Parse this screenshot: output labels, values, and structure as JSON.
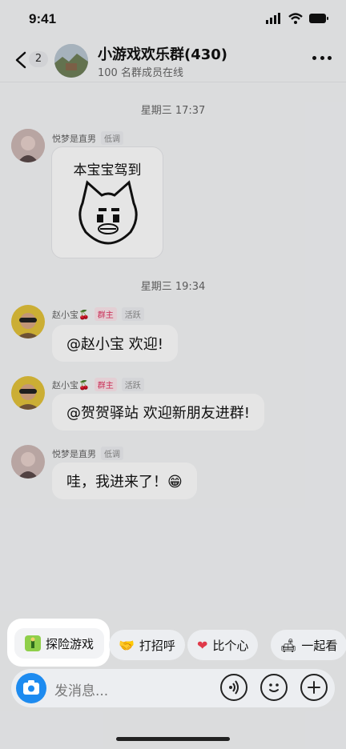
{
  "status": {
    "time": "9:41"
  },
  "header": {
    "unread": "2",
    "title": "小游戏欢乐群(430)",
    "subtitle": "100 名群成员在线"
  },
  "messages": {
    "sep1": "星期三 17:37",
    "m1_name": "悦梦是直男",
    "m1_tag": "低调",
    "sticker_caption": "本宝宝驾到",
    "sep2": "星期三 19:34",
    "m2_name": "赵小宝🍒",
    "m2_tag_owner": "群主",
    "m2_tag_active": "活跃",
    "m2_text": "@赵小宝 欢迎!",
    "m3_name": "赵小宝🍒",
    "m3_tag_owner": "群主",
    "m3_tag_active": "活跃",
    "m3_text": "@贺贺驿站 欢迎新朋友进群!",
    "m4_name": "悦梦是直男",
    "m4_tag": "低调",
    "m4_text": "哇，我进来了！😁"
  },
  "quick_actions": {
    "a1": "探险游戏",
    "a2": "打招呼",
    "a3": "比个心",
    "a4": "一起看"
  },
  "input": {
    "placeholder": "发消息..."
  },
  "colors": {
    "accent": "#1d8bf0",
    "owner_tag": "#e0325f"
  }
}
